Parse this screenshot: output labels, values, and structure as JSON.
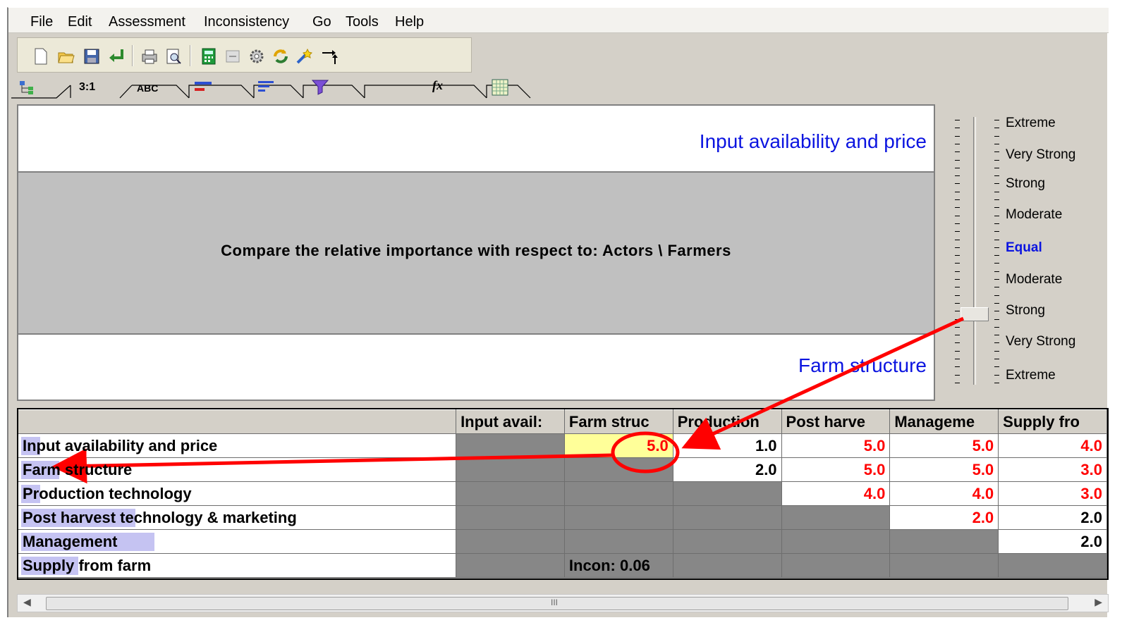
{
  "menu": [
    "File",
    "Edit",
    "Assessment",
    "Inconsistency",
    "Go",
    "Tools",
    "Help"
  ],
  "toolbar_icons": [
    "new-icon",
    "open-icon",
    "save-icon",
    "undo-icon",
    "print-icon",
    "print-preview-icon",
    "calculator-icon",
    "inactive-icon",
    "gear-icon",
    "refresh-icon",
    "magic-icon",
    "arrows-icon"
  ],
  "tabs": [
    "tree-icon",
    "3:1",
    "ABC",
    "bar-chart-icon",
    "sort-icon",
    "funnel-icon",
    "fx-icon",
    "table-icon"
  ],
  "tab_text": {
    "numeric": "3:1",
    "verbal": "ABC",
    "formula": "fx"
  },
  "comparison": {
    "top_item": "Input availability and price",
    "bottom_item": "Farm structure",
    "prompt": "Compare the relative importance with respect to: Actors  \\ Farmers"
  },
  "scale": {
    "labels": [
      "Extreme",
      "Very Strong",
      "Strong",
      "Moderate",
      "Equal",
      "Moderate",
      "Strong",
      "Very Strong",
      "Extreme"
    ],
    "selected": "Strong (toward Farm structure)"
  },
  "matrix": {
    "columns": [
      "Input avail:",
      "Farm struc",
      "Production",
      "Post harve",
      "Manageme",
      "Supply fro"
    ],
    "rows": [
      {
        "name": "Input availability and price",
        "highlight_chars": 2,
        "cells": [
          null,
          "5.0",
          "1.0",
          "5.0",
          "5.0",
          "4.0"
        ],
        "colors": [
          null,
          "red",
          "black",
          "red",
          "red",
          "red"
        ]
      },
      {
        "name": "Farm structure",
        "highlight_chars": 4,
        "cells": [
          null,
          null,
          "2.0",
          "5.0",
          "5.0",
          "3.0"
        ],
        "colors": [
          null,
          null,
          "black",
          "red",
          "red",
          "red"
        ]
      },
      {
        "name": "Production technology",
        "highlight_chars": 2,
        "cells": [
          null,
          null,
          null,
          "4.0",
          "4.0",
          "3.0"
        ],
        "colors": [
          null,
          null,
          null,
          "red",
          "red",
          "red"
        ]
      },
      {
        "name": "Post harvest technology & marketing",
        "highlight_chars": 12,
        "cells": [
          null,
          null,
          null,
          null,
          "2.0",
          "2.0"
        ],
        "colors": [
          null,
          null,
          null,
          null,
          "red",
          "black"
        ]
      },
      {
        "name": "Management",
        "highlight_chars": 14,
        "cells": [
          null,
          null,
          null,
          null,
          null,
          "2.0"
        ],
        "colors": [
          null,
          null,
          null,
          null,
          null,
          "black"
        ]
      },
      {
        "name": "Supply from farm",
        "highlight_chars": 6,
        "cells": [
          null,
          null,
          null,
          null,
          null,
          null
        ],
        "colors": [
          null,
          null,
          null,
          null,
          null,
          null
        ]
      }
    ],
    "inconsistency": "Incon: 0.06"
  },
  "scrollbar": {
    "grip": "III"
  },
  "colors": {
    "accent_blue": "#0b14e0",
    "red": "#ff0000",
    "selected_cell": "#ffff99",
    "annotation": "#ff0000"
  }
}
